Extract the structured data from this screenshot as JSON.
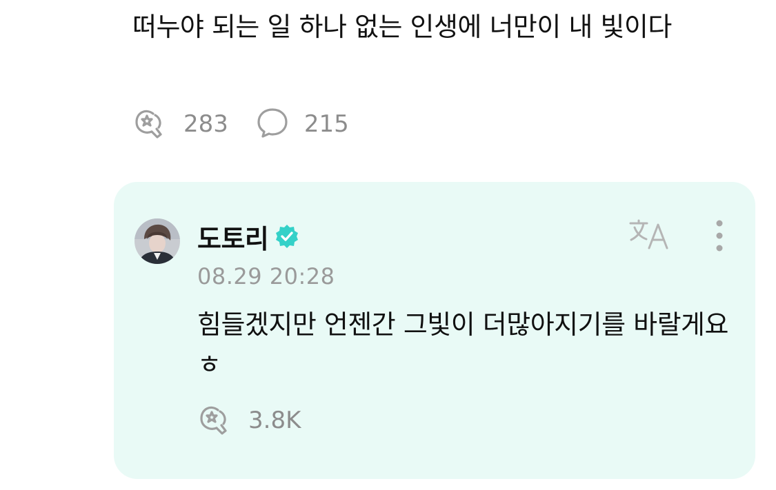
{
  "post": {
    "text": "떠누야 되는 일 하나 없는 인생에 너만이 내 빛이다",
    "like_count": "283",
    "comment_count": "215"
  },
  "reply": {
    "author": "도토리",
    "verified": true,
    "timestamp": "08.29 20:28",
    "text": "힘들겠지만 언젠간 그빛이 더많아지기를 바랄게요 ㅎ",
    "like_count": "3.8K"
  },
  "colors": {
    "reply_background": "#e9faf6",
    "verified_badge": "#34d1c8",
    "muted_text": "#8c8c8c",
    "icon_gray": "#9e9e9e"
  },
  "icons": {
    "like": "star-hand-icon",
    "comment": "speech-bubble-icon",
    "translate": "translate-icon",
    "more": "more-vertical-icon",
    "verified": "verified-badge-icon"
  }
}
